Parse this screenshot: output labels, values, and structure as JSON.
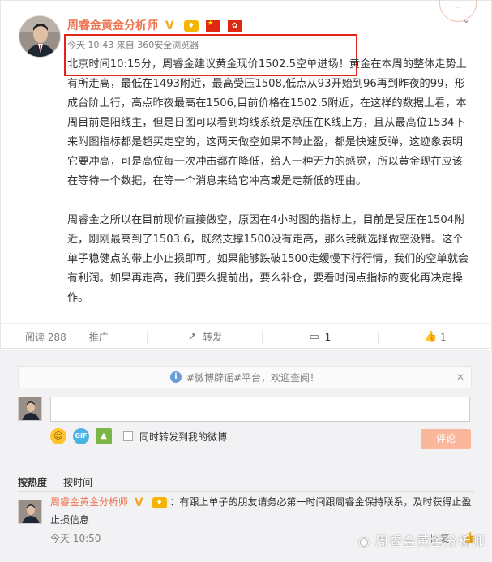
{
  "post": {
    "author": "周睿金黄金分析师",
    "badges": [
      "verified-v-icon",
      "vip-badge-icon",
      "china-flag-icon",
      "hongkong-flag-icon"
    ],
    "time": "今天 10:43",
    "via": "来自 360安全浏览器",
    "paragraph1": "北京时间10:15分，周睿金建议黄金现价1502.5空单进场！黄金在本周的整体走势上有所走高，最低在1493附近，最高受压1508,低点从93开始到96再到昨夜的99，形成台阶上行，高点昨夜最高在1506,目前价格在1502.5附近，在这样的数据上看，本周目前是阳线主，但是日图可以看到均线系统是承压在K线上方，且从最高位1534下来附图指标都是超买走空的，这两天做空如果不带止盈，都是快速反弹，这迹象表明它要冲高，可是高位每一次冲击都在降低，给人一种无力的感觉，所以黄金现在应该在等待一个数据，在等一个消息来给它冲高或是走新低的理由。",
    "paragraph2": "周睿金之所以在目前现价直接做空，原因在4小时图的指标上，目前是受压在1504附近，刚刚最高到了1503.6，既然支撑1500没有走高，那么我就选择做空没错。这个单子稳健点的带上小止损即可。如果能够跌破1500走缓慢下行行情，我们的空单就会有利润。如果再走高，我们要么提前出，要么补仓，要看时间点指标的变化再决定操作。"
  },
  "actions": {
    "reads": "阅读 288",
    "promote": "推广",
    "repost": "转发",
    "comment_count": "1",
    "like_count": "1"
  },
  "comments": {
    "notice": "#微博辟谣#平台，欢迎查阅！",
    "repost_option": "同时转发到我的微博",
    "post_button": "评论",
    "sort_hot": "按热度",
    "sort_time": "按时间",
    "items": [
      {
        "author": "周睿金黄金分析师",
        "text": "：有跟上单子的朋友请务必第一时间跟周睿金保持联系，及时获得止盈止损信息",
        "time": "今天 10:50",
        "reply": "回复"
      }
    ]
  },
  "watermark": "周睿金黄金分析师"
}
